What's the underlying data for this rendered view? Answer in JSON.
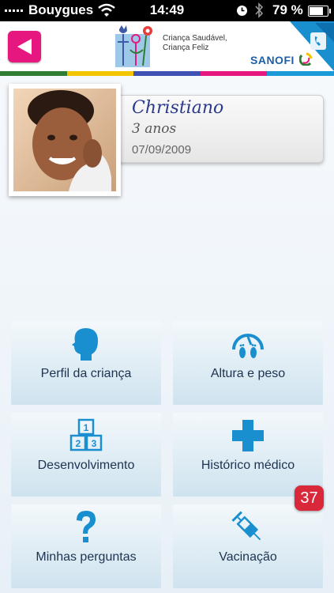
{
  "status_bar": {
    "carrier": "Bouygues",
    "time": "14:49",
    "battery_percent_label": "79 %",
    "battery_level": 0.79
  },
  "header": {
    "logo_line1": "Criança Saudável,",
    "logo_line2": "Criança Feliz",
    "brand": "SANOFI",
    "accent_color": "#e6177e",
    "band_colors": [
      "#2e7d32",
      "#f2c500",
      "#3f51b5",
      "#e6177e",
      "#1a9bd7"
    ]
  },
  "profile": {
    "name": "Christiano",
    "age": "3 anos",
    "birth_date": "07/09/2009"
  },
  "menu": [
    {
      "label": "Perfil da criança",
      "icon": "child-head-icon"
    },
    {
      "label": "Altura e peso",
      "icon": "scale-feet-icon"
    },
    {
      "label": "Desenvolvimento",
      "icon": "blocks-icon"
    },
    {
      "label": "Histórico médico",
      "icon": "medical-cross-icon"
    },
    {
      "label": "Minhas perguntas",
      "icon": "question-mark-icon"
    },
    {
      "label": "Vacinação",
      "icon": "syringe-icon"
    }
  ],
  "vaccination_badge": "37"
}
